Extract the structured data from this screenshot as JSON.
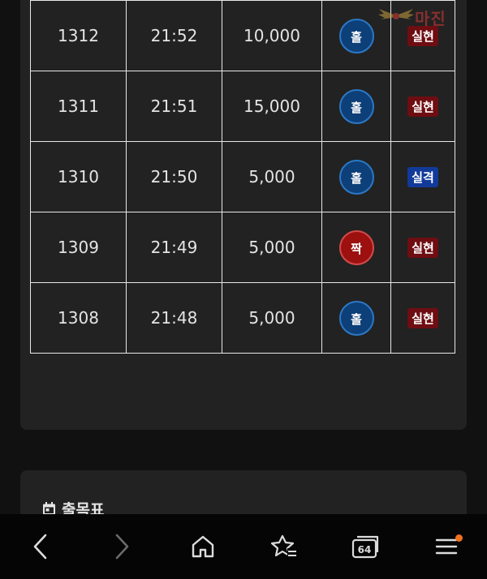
{
  "history": {
    "rows": [
      {
        "round": "1312",
        "time": "21:52",
        "amount": "10,000",
        "pick": "홀",
        "pick_type": "odd",
        "result": "실현",
        "result_type": "hit"
      },
      {
        "round": "1311",
        "time": "21:51",
        "amount": "15,000",
        "pick": "홀",
        "pick_type": "odd",
        "result": "실현",
        "result_type": "hit"
      },
      {
        "round": "1310",
        "time": "21:50",
        "amount": "5,000",
        "pick": "홀",
        "pick_type": "odd",
        "result": "실격",
        "result_type": "miss"
      },
      {
        "round": "1309",
        "time": "21:49",
        "amount": "5,000",
        "pick": "짝",
        "pick_type": "even",
        "result": "실현",
        "result_type": "hit"
      },
      {
        "round": "1308",
        "time": "21:48",
        "amount": "5,000",
        "pick": "홀",
        "pick_type": "odd",
        "result": "실현",
        "result_type": "hit"
      }
    ]
  },
  "watermark": {
    "text": "마진"
  },
  "section": {
    "title": "출목표",
    "icon": "calendar-icon"
  },
  "navbar": {
    "items": [
      {
        "name": "back",
        "icon": "chevron-left-icon"
      },
      {
        "name": "forward",
        "icon": "chevron-right-icon"
      },
      {
        "name": "home",
        "icon": "home-icon"
      },
      {
        "name": "favorites",
        "icon": "star-plus-icon"
      },
      {
        "name": "tabs",
        "icon": "tabs-icon",
        "count": "64"
      },
      {
        "name": "menu",
        "icon": "menu-icon"
      }
    ]
  },
  "colors": {
    "odd_pick": "#0d3f78",
    "even_pick": "#9c1010",
    "hit_badge": "#6e0d12",
    "miss_badge": "#123a9a",
    "notification": "#f07020"
  }
}
